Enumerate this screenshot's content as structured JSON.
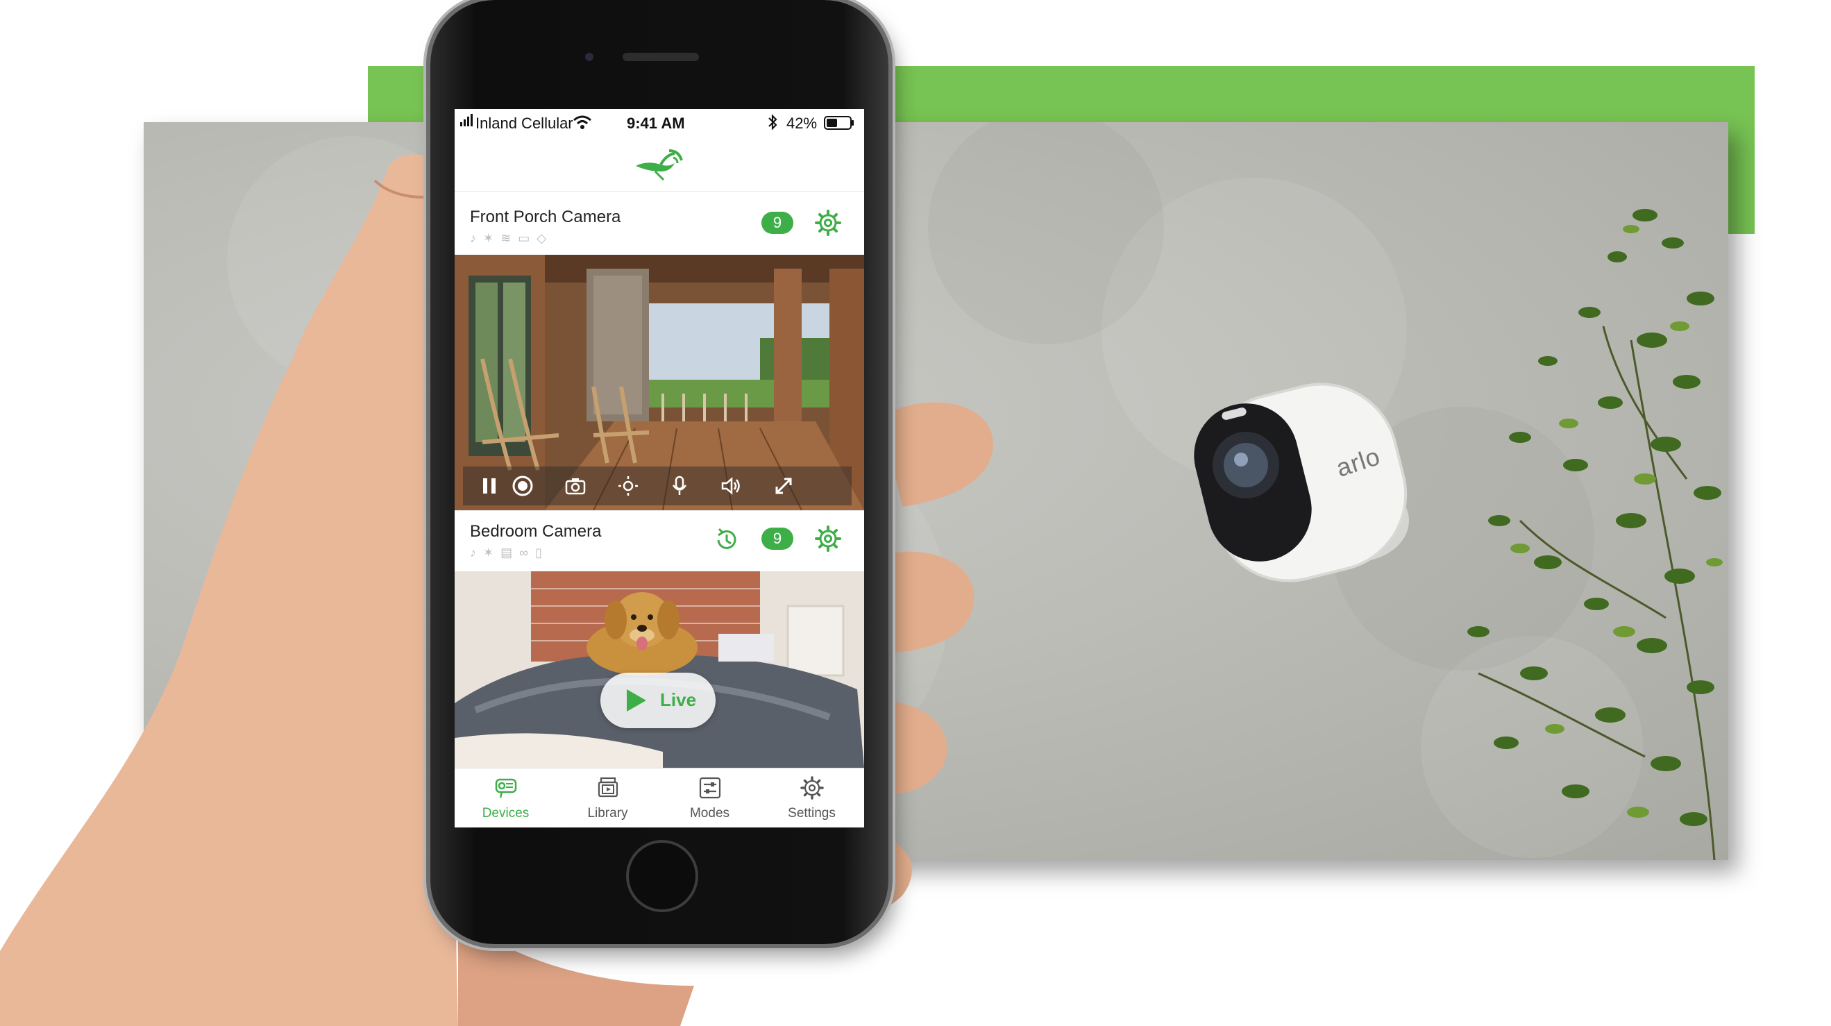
{
  "status_bar": {
    "carrier": "Inland Cellular",
    "time": "9:41 AM",
    "battery": "42%"
  },
  "app": {
    "logo_icon": "arlo-bird-logo-icon"
  },
  "cameras": [
    {
      "name": "Front Porch Camera",
      "badge": "9"
    },
    {
      "name": "Bedroom Camera",
      "badge": "9"
    }
  ],
  "live_button": {
    "label": "Live"
  },
  "tabs": [
    {
      "label": "Devices",
      "active": true
    },
    {
      "label": "Library",
      "active": false
    },
    {
      "label": "Modes",
      "active": false
    },
    {
      "label": "Settings",
      "active": false
    }
  ],
  "camera_product": {
    "brand": "arlo"
  },
  "colors": {
    "accent_green": "#3dae48",
    "banner_green": "#77c353",
    "wall_gray": "#bcbcb7"
  }
}
